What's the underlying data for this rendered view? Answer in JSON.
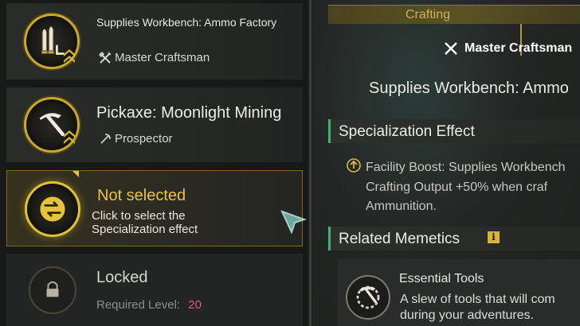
{
  "list": {
    "items": [
      {
        "title": "Supplies Workbench: Ammo Factory",
        "subtitle": "Master Craftsman",
        "icon": "ammo-icon"
      },
      {
        "title": "Pickaxe: Moonlight Mining",
        "subtitle": "Prospector",
        "icon": "pickaxe-icon"
      },
      {
        "title": "Not selected",
        "subtitle": "Click to select the Specialization effect",
        "icon": "swap-arrows-icon"
      },
      {
        "title": "Locked",
        "level_label": "Required Level:",
        "level_value": "20",
        "icon": "lock-icon"
      }
    ]
  },
  "detail": {
    "tab_label": "Crafting",
    "role": "Master Craftsman",
    "title": "Supplies Workbench: Ammo",
    "specialization_heading": "Specialization Effect",
    "specialization_lines": [
      "Facility Boost: Supplies Workbench",
      "Crafting Output +50% when craf",
      "Ammunition."
    ],
    "related_heading": "Related Memetics",
    "memetic": {
      "name": "Essential Tools",
      "desc_lines": [
        "A slew of tools that will com",
        "during your adventures."
      ]
    }
  },
  "colors": {
    "accent_gold": "#e8c43b",
    "section_marker": "#3ab86b",
    "level_value": "#e2587a"
  }
}
